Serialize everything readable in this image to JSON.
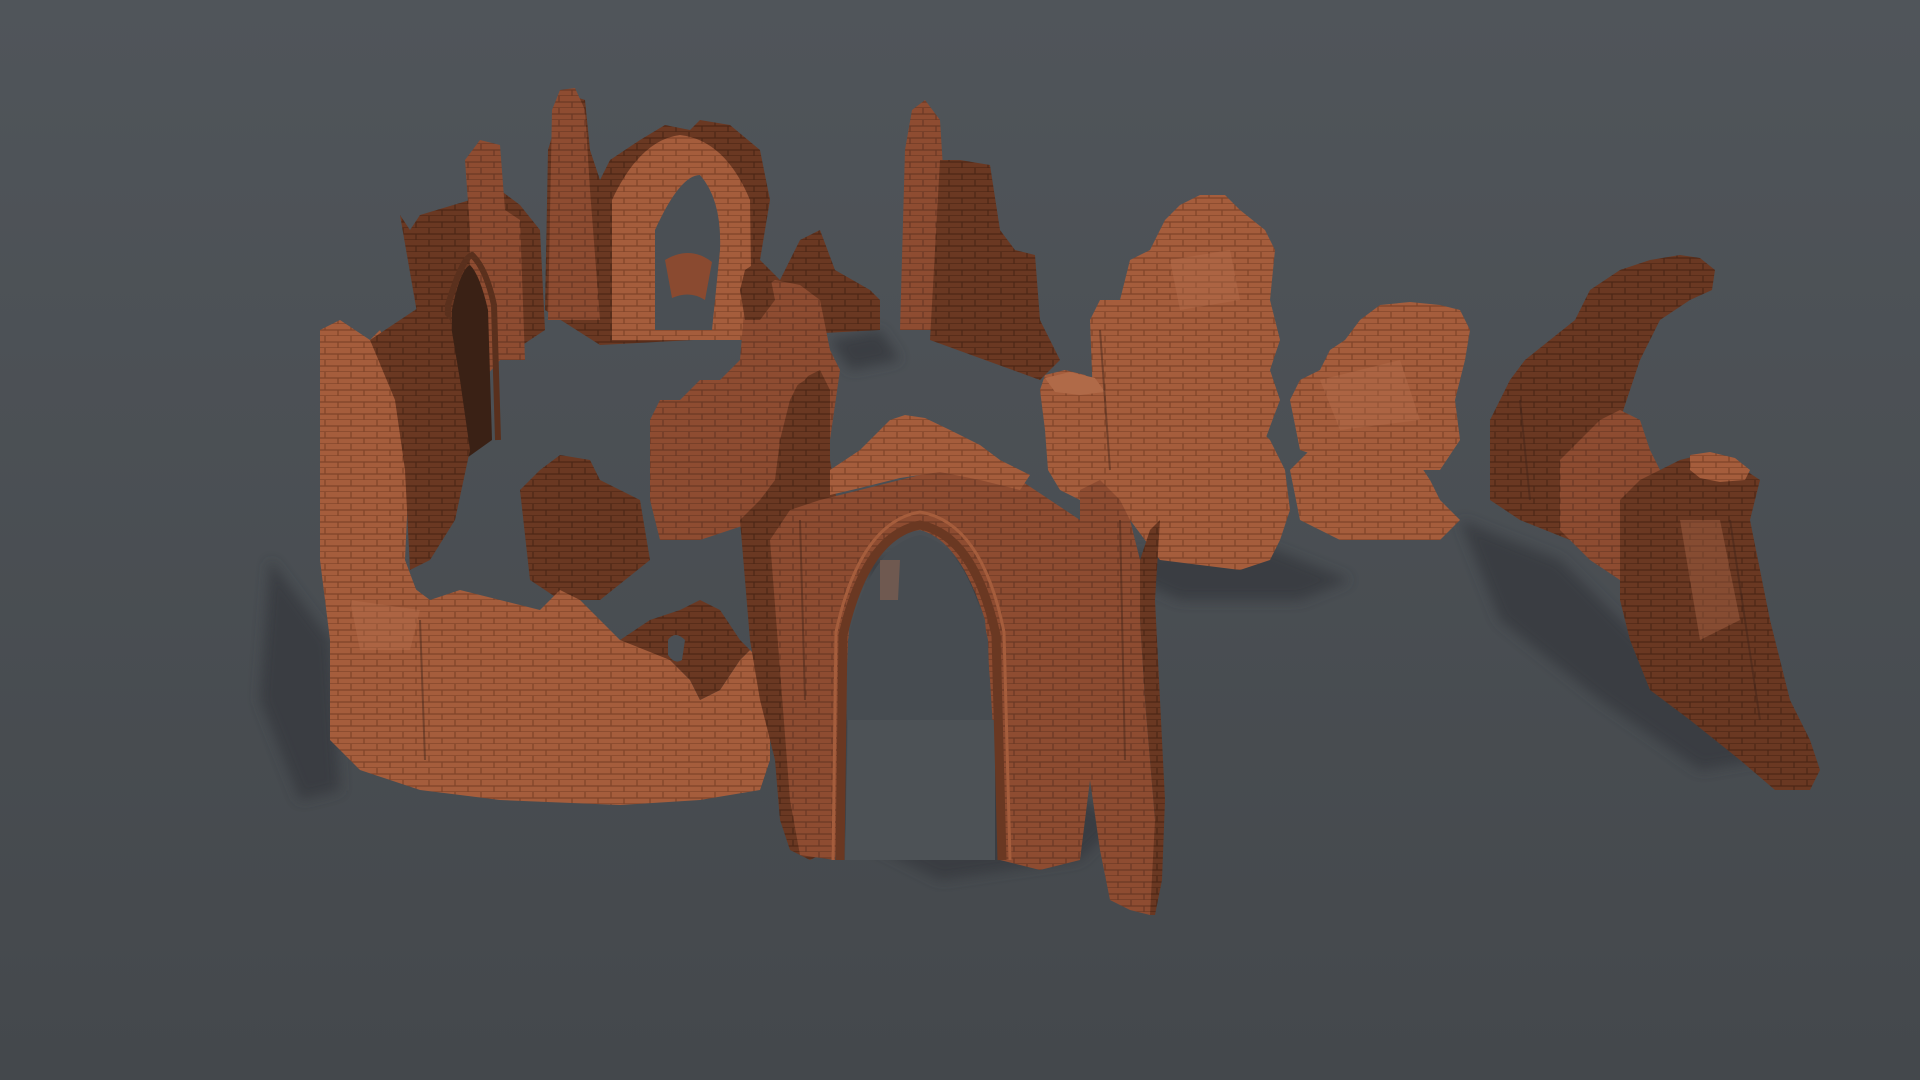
{
  "scene": {
    "subject": "ruined-gothic-brick-walls-3d-render",
    "colors": {
      "background_top": "#50555a",
      "background_bottom": "#44484c",
      "shadow": "#3a3d41",
      "brick_light": "#a8603f",
      "brick_mid": "#8a4a30",
      "brick_dark": "#5e321f",
      "brick_deep": "#41220f",
      "mortar": "#7b6e63",
      "arch_shadow": "#2e1a10"
    }
  }
}
